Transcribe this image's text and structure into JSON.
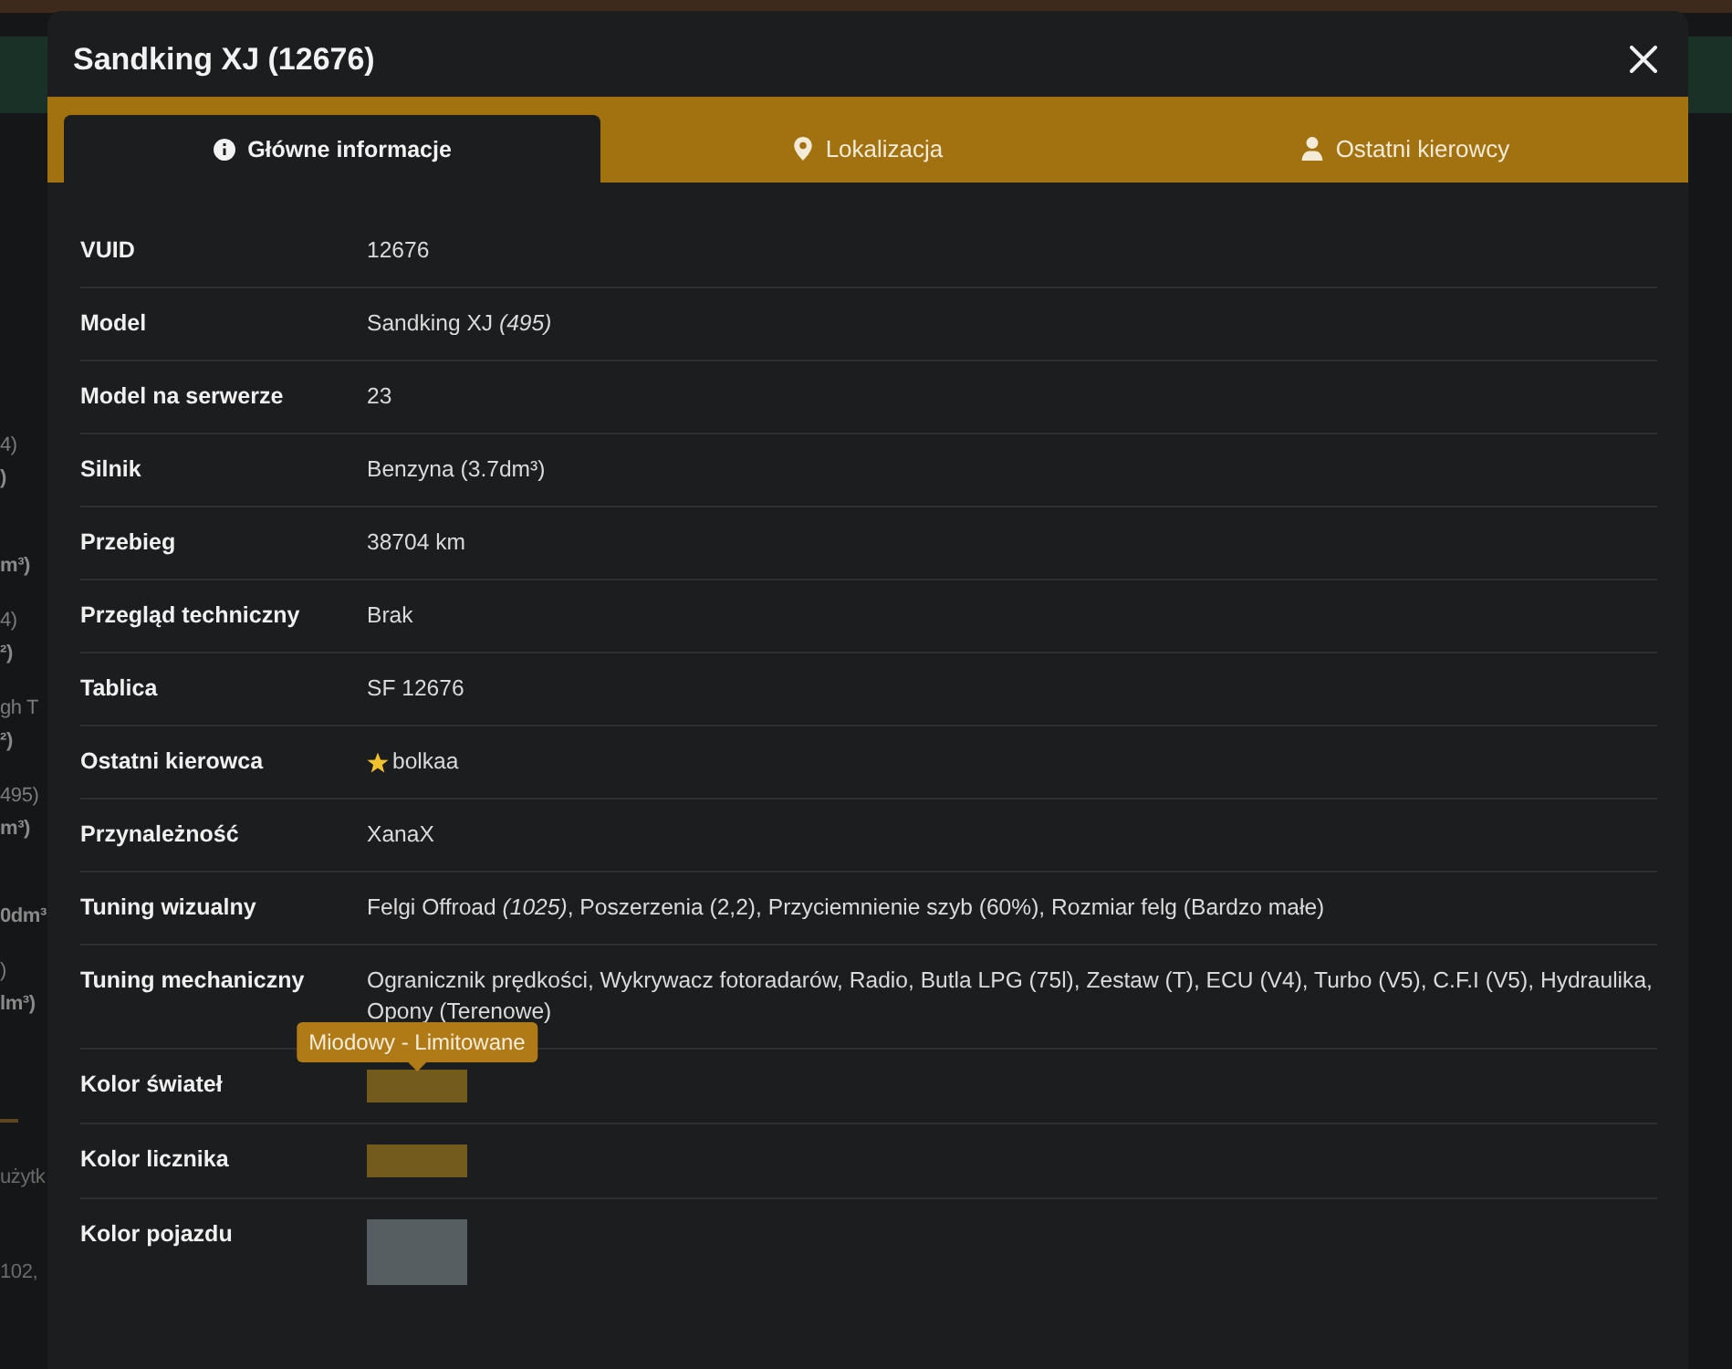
{
  "background": {
    "cells": [
      {
        "lines": [
          "4)",
          ")"
        ]
      },
      {
        "lines": [
          "m³)"
        ]
      },
      {
        "lines": [
          "4)",
          "²)"
        ]
      },
      {
        "lines": [
          "gh T",
          "²)"
        ]
      },
      {
        "lines": [
          "495)",
          "m³)"
        ]
      },
      {
        "lines": [
          "0dm³"
        ]
      },
      {
        "lines": [
          ")",
          "lm³)"
        ]
      }
    ],
    "texts": [
      "użytk",
      "102,"
    ]
  },
  "modal": {
    "title": "Sandking XJ (12676)",
    "tabs": [
      {
        "label": "Główne informacje",
        "selected": true
      },
      {
        "label": "Lokalizacja",
        "selected": false
      },
      {
        "label": "Ostatni kierowcy",
        "selected": false
      }
    ],
    "rows": [
      {
        "label": "VUID",
        "kind": "text",
        "value": "12676"
      },
      {
        "label": "Model",
        "kind": "text",
        "value": "Sandking XJ *(495)*"
      },
      {
        "label": "Model na serwerze",
        "kind": "text",
        "value": "23"
      },
      {
        "label": "Silnik",
        "kind": "text",
        "value": "Benzyna (3.7dm³)"
      },
      {
        "label": "Przebieg",
        "kind": "text",
        "value": "38704 km"
      },
      {
        "label": "Przegląd techniczny",
        "kind": "text",
        "value": "Brak"
      },
      {
        "label": "Tablica",
        "kind": "text",
        "value": "SF 12676"
      },
      {
        "label": "Ostatni kierowca",
        "kind": "driver",
        "value": "bolkaa"
      },
      {
        "label": "Przynależność",
        "kind": "text",
        "value": "XanaX"
      },
      {
        "label": "Tuning wizualny",
        "kind": "text",
        "value": "Felgi Offroad *(1025)*, Poszerzenia (2,2), Przyciemnienie szyb (60%), Rozmiar felg (Bardzo małe)"
      },
      {
        "label": "Tuning mechaniczny",
        "kind": "text",
        "value": "Ogranicznik prędkości, Wykrywacz fotoradarów, Radio, Butla LPG (75l), Zestaw (T), ECU (V4), Turbo (V5), C.F.I (V5), Hydraulika, Opony (Terenowe)"
      },
      {
        "label": "Kolor świateł",
        "kind": "swatch",
        "color": "#735a1d",
        "tooltip": "Miodowy - Limitowane"
      },
      {
        "label": "Kolor licznika",
        "kind": "swatch",
        "color": "#735a1d"
      },
      {
        "label": "Kolor pojazdu",
        "kind": "paint",
        "color": "#575e62"
      }
    ]
  }
}
